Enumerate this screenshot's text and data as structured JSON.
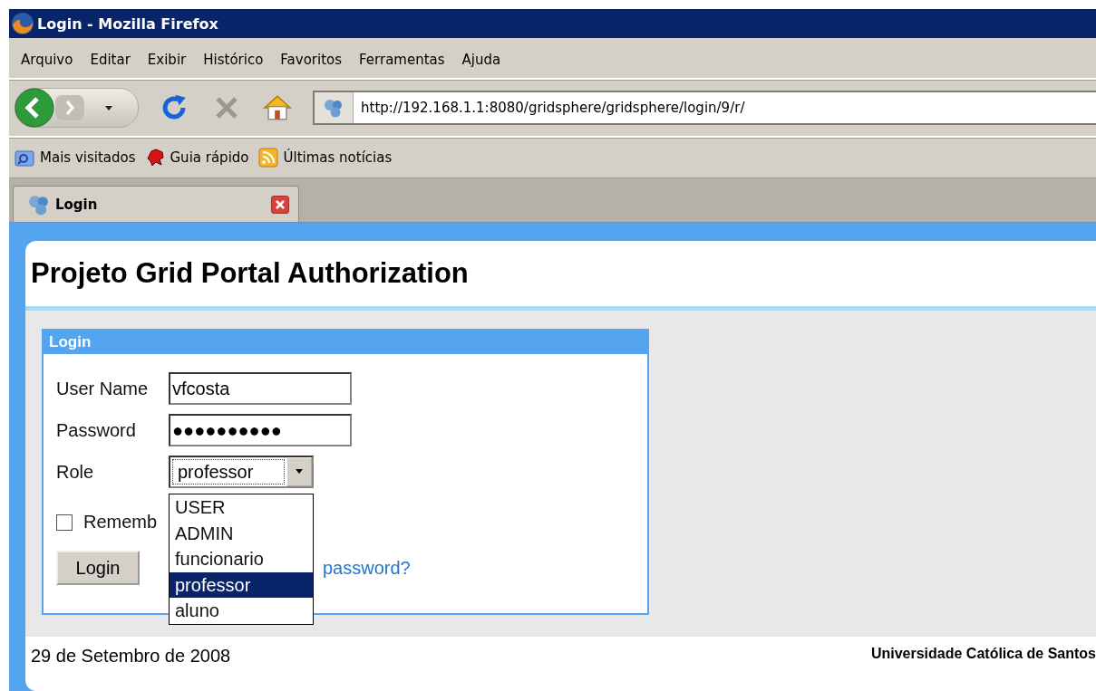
{
  "window": {
    "title": "Login - Mozilla Firefox"
  },
  "menu": [
    "Arquivo",
    "Editar",
    "Exibir",
    "Histórico",
    "Favoritos",
    "Ferramentas",
    "Ajuda"
  ],
  "address": {
    "url": "http://192.168.1.1:8080/gridsphere/gridsphere/login/9/r/"
  },
  "bookmarks": [
    {
      "label": "Mais visitados",
      "kind": "folder"
    },
    {
      "label": "Guia rápido",
      "kind": "guide"
    },
    {
      "label": "Últimas notícias",
      "kind": "feed"
    }
  ],
  "tabs": [
    {
      "label": "Login",
      "selected": true
    }
  ],
  "page": {
    "title": "Projeto Grid Portal Authorization",
    "login_panel": {
      "title": "Login",
      "fields": [
        {
          "label": "User Name",
          "value": "vfcosta"
        },
        {
          "label": "Password",
          "value": "●●●●●●●●●●"
        }
      ],
      "role": {
        "label": "Role",
        "value": "professor",
        "options": [
          {
            "label": "USER",
            "selected": false
          },
          {
            "label": "ADMIN",
            "selected": false
          },
          {
            "label": "funcionario",
            "selected": false
          },
          {
            "label": "professor",
            "selected": true
          },
          {
            "label": "aluno",
            "selected": false
          }
        ]
      },
      "remember": {
        "label": "Rememb",
        "checked": false
      },
      "button": "Login",
      "link": "password?"
    },
    "footer": {
      "date": "29 de Setembro de 2008",
      "org": "Universidade Católica de Santos"
    }
  }
}
